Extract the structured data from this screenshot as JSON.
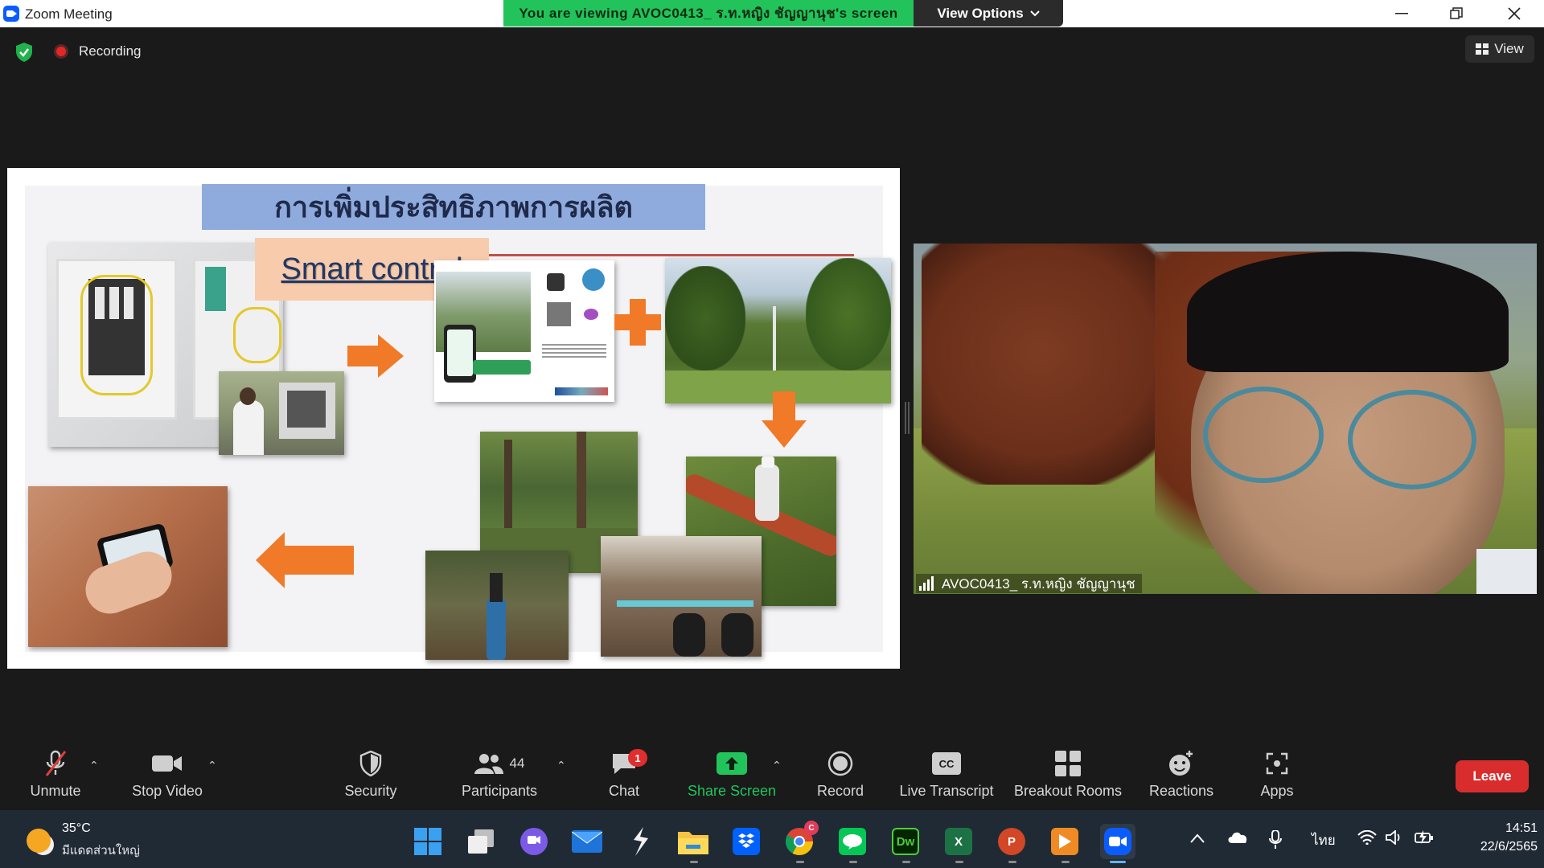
{
  "window": {
    "title": "Zoom Meeting",
    "banner": "You are viewing AVOC0413_ ร.ท.หญิง ชัญญานุช's screen",
    "view_options": "View Options",
    "controls": [
      "minimize",
      "restore",
      "close"
    ]
  },
  "header": {
    "recording_label": "Recording",
    "view_label": "View"
  },
  "slide": {
    "title": "การเพิ่มประสิทธิภาพการผลิต",
    "smart_label": "Smart control"
  },
  "participant": {
    "name": "AVOC0413_ ร.ท.หญิง ชัญญานุช"
  },
  "toolbar": {
    "unmute": "Unmute",
    "stop_video": "Stop Video",
    "security": "Security",
    "participants": "Participants",
    "participants_count": "44",
    "chat": "Chat",
    "chat_badge": "1",
    "share_screen": "Share Screen",
    "record": "Record",
    "live_transcript": "Live Transcript",
    "breakout_rooms": "Breakout Rooms",
    "reactions": "Reactions",
    "apps": "Apps",
    "leave": "Leave",
    "share_color": "#22c35b",
    "leave_color": "#d92d2d"
  },
  "taskbar": {
    "weather_temp": "35°C",
    "weather_desc": "มีแดดส่วนใหญ่",
    "language": "ไทย",
    "time": "14:51",
    "date": "22/6/2565",
    "apps": [
      "start-icon",
      "task-view-icon",
      "teams-chat-icon",
      "mail-icon",
      "winamp-icon",
      "file-explorer-icon",
      "dropbox-icon",
      "chrome-icon",
      "line-icon",
      "dreamweaver-icon",
      "excel-icon",
      "powerpoint-icon",
      "media-player-icon",
      "zoom-icon"
    ],
    "dreamweaver_label": "Dw",
    "excel_label": "X",
    "powerpoint_label": "P",
    "chrome_badge": "C"
  }
}
